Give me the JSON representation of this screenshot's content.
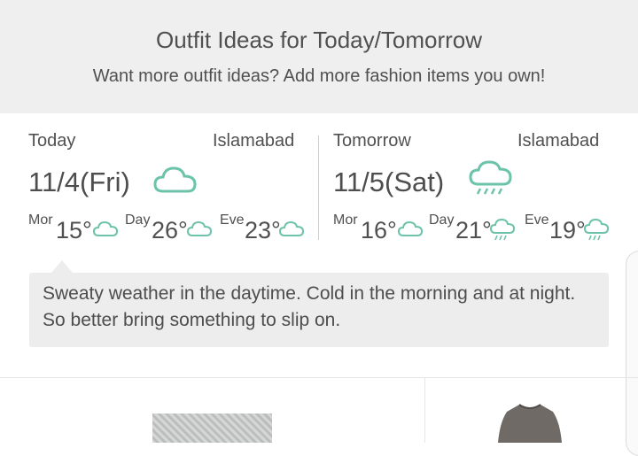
{
  "header": {
    "title": "Outfit Ideas for Today/Tomorrow",
    "subtitle": "Want more outfit ideas? Add more fashion items you own!"
  },
  "today": {
    "label": "Today",
    "city": "Islamabad",
    "date": "11/4(Fri)",
    "icon": "cloud-icon",
    "periods": [
      {
        "label": "Mor",
        "temp": "15°",
        "icon": "cloud-icon"
      },
      {
        "label": "Day",
        "temp": "26°",
        "icon": "cloud-icon"
      },
      {
        "label": "Eve",
        "temp": "23°",
        "icon": "cloud-icon"
      }
    ]
  },
  "tomorrow": {
    "label": "Tomorrow",
    "city": "Islamabad",
    "date": "11/5(Sat)",
    "icon": "rain-cloud-icon",
    "periods": [
      {
        "label": "Mor",
        "temp": "16°",
        "icon": "cloud-icon"
      },
      {
        "label": "Day",
        "temp": "21°",
        "icon": "rain-cloud-icon"
      },
      {
        "label": "Eve",
        "temp": "19°",
        "icon": "rain-cloud-icon"
      }
    ]
  },
  "advice": {
    "line1": "Sweaty weather in the daytime. Cold in the morning and at night.",
    "line2": "So better bring something to slip on."
  },
  "colors": {
    "accent": "#6cc3aa",
    "header_bg": "#efefef",
    "tip_bg": "#ededed"
  }
}
